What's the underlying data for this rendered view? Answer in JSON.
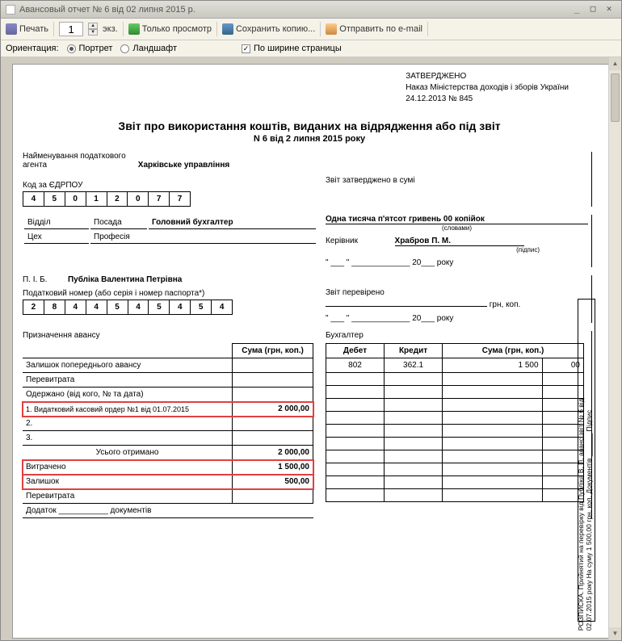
{
  "window": {
    "title": "Авансовый отчет № 6 від 02 липня 2015 р."
  },
  "toolbar": {
    "print": "Печать",
    "copies": "1",
    "copies_unit": "экз.",
    "view_only": "Только просмотр",
    "save_copy": "Сохранить копию...",
    "send_email": "Отправить по e-mail"
  },
  "toolbar2": {
    "orientation": "Ориентация:",
    "portrait": "Портрет",
    "landscape": "Ландшафт",
    "fit_width": "По ширине страницы"
  },
  "approval": {
    "line1": "ЗАТВЕРДЖЕНО",
    "line2": "Наказ Міністерства доходів і зборів України",
    "line3": "24.12.2013 № 845"
  },
  "doc": {
    "title": "Звіт про використання коштів, виданих на відрядження або під звіт",
    "subtitle": "N 6 від 2 липня 2015 року",
    "agent_label": "Найменування податкового агента",
    "agent_name": "Харківське управління",
    "edrpou_label": "Код за ЄДРПОУ",
    "edrpou": [
      "4",
      "5",
      "0",
      "1",
      "2",
      "0",
      "7",
      "7"
    ],
    "viddil": "Відділ",
    "posada": "Посада",
    "posada_val": "Головний бухгалтер",
    "tseh": "Цех",
    "profesia": "Професія",
    "approved_sum_label": "Звіт затверджено в сумі",
    "sum_words": "Одна тисяча п'ятсот гривень 00 копійок",
    "sum_words_note": "(словами)",
    "kerivnyk": "Керівник",
    "kerivnyk_name": "Храбров П. М.",
    "signature_note": "(підпис)",
    "date_stub": "\" ___ \" _____________ 20___ року",
    "pib_label": "П. І. Б.",
    "pib": "Публіка Валентина Петрівна",
    "tax_num_label": "Податковий номер (або серія і номер паспорта*)",
    "tax_num": [
      "2",
      "8",
      "4",
      "4",
      "5",
      "4",
      "5",
      "4",
      "5",
      "4"
    ],
    "verified_label": "Звіт перевірено",
    "grn_kop": "грн, коп.",
    "accountant": "Бухгалтер",
    "purpose": "Призначення авансу",
    "advance_sum_header": "Сума (грн, коп.)",
    "prev_balance": "Залишок попереднього авансу",
    "overspend": "Перевитрата",
    "received_from": "Одержано (від кого, № та дата)",
    "received_1": "1. Видатковий касовий ордер №1 від 01.07.2015",
    "received_1_amt": "2 000,00",
    "received_2": "2.",
    "received_3": "3.",
    "total_received": "Усього отримано",
    "total_received_amt": "2 000,00",
    "spent": "Витрачено",
    "spent_amt": "1 500,00",
    "balance": "Залишок",
    "balance_amt": "500,00",
    "overspend2": "Перевитрата",
    "addendum": "Додаток ___________ документів",
    "debit": "Дебет",
    "credit": "Кредит",
    "dc_sum": "Сума (грн, коп.)",
    "dc_rows": [
      {
        "d": "802",
        "c": "362.1",
        "s1": "1 500",
        "s2": "00"
      }
    ]
  },
  "receipt": {
    "line1": "РОЗПИСКА. Прийнятий на перевірку від Публіка В. П. аванс.звіт № 6 від",
    "line2": "02.07.2015 року  На суму 1 500,00 грн, коп.  Документів ______  Підпис"
  }
}
